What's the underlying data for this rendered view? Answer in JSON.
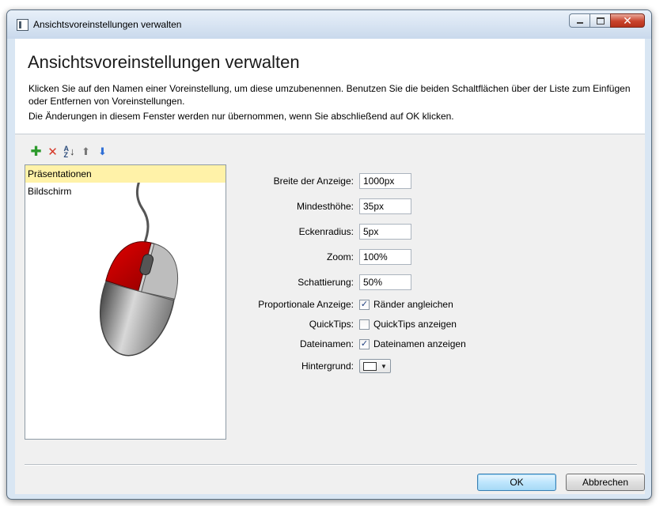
{
  "window": {
    "title": "Ansichtsvoreinstellungen verwalten",
    "minimize_label": "",
    "maximize_label": "",
    "close_label": "✕"
  },
  "header": {
    "heading": "Ansichtsvoreinstellungen verwalten",
    "description_line1": "Klicken Sie auf den Namen einer Voreinstellung, um diese umzubenennen. Benutzen Sie die beiden Schaltflächen über der Liste zum Einfügen oder Entfernen von Voreinstellungen.",
    "description_line2": "Die Änderungen in diesem Fenster werden nur übernommen, wenn Sie abschließend auf OK klicken."
  },
  "toolbar": {
    "icons": [
      "add-icon",
      "delete-icon",
      "sort-az-icon",
      "move-up-icon",
      "move-down-icon"
    ],
    "sort_letters_top": "A",
    "sort_letters_bottom": "Z"
  },
  "presets": {
    "items": [
      {
        "label": "Präsentationen",
        "selected": true
      },
      {
        "label": "Bildschirm",
        "selected": false
      }
    ],
    "selected_color": "#fff2a8"
  },
  "form": {
    "width_label": "Breite der Anzeige:",
    "width_value": "1000px",
    "min_height_label": "Mindesthöhe:",
    "min_height_value": "35px",
    "corner_radius_label": "Eckenradius:",
    "corner_radius_value": "5px",
    "zoom_label": "Zoom:",
    "zoom_value": "100%",
    "shading_label": "Schattierung:",
    "shading_value": "50%",
    "proportional_label": "Proportionale Anzeige:",
    "proportional_checkbox_label": "Ränder angleichen",
    "proportional_checked": true,
    "quicktips_label": "QuickTips:",
    "quicktips_checkbox_label": "QuickTips anzeigen",
    "quicktips_checked": false,
    "filenames_label": "Dateinamen:",
    "filenames_checkbox_label": "Dateinamen anzeigen",
    "filenames_checked": true,
    "background_label": "Hintergrund:",
    "background_color": "#ffffff"
  },
  "footer": {
    "ok_label": "OK",
    "cancel_label": "Abbrechen"
  }
}
